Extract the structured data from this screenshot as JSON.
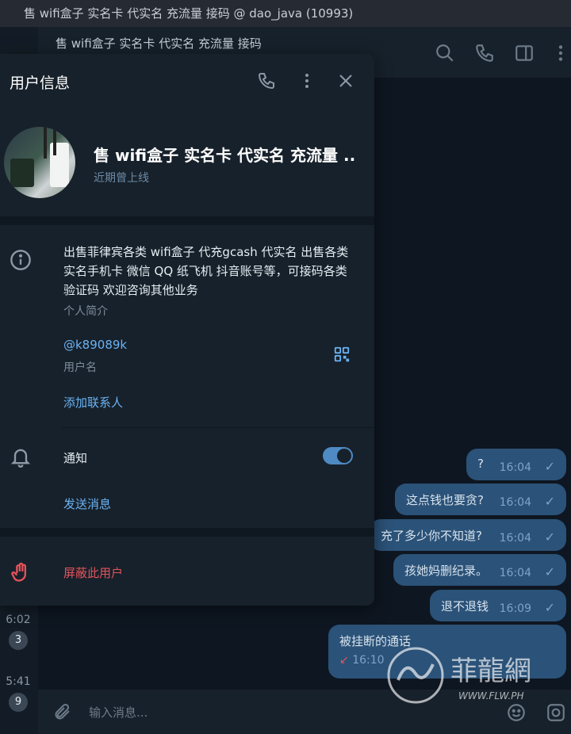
{
  "window": {
    "title": "售 wifi盒子 实名卡 代实名 充流量 接码 @ dao_java (10993)"
  },
  "chat_header": {
    "title": "售 wifi盒子 实名卡 代实名 充流量 接码"
  },
  "left_list": [
    {
      "time": "6:02",
      "badge": "3"
    },
    {
      "time": "5:41",
      "badge": "9"
    }
  ],
  "messages": [
    {
      "text": "?",
      "time": "16:04"
    },
    {
      "text": "这点钱也要贪?",
      "time": "16:04"
    },
    {
      "text": "充了多少你不知道?",
      "time": "16:04"
    },
    {
      "text": "孩她妈删纪录。",
      "time": "16:04"
    },
    {
      "text": "退不退钱",
      "time": "16:09"
    },
    {
      "text": "被挂断的通话",
      "time": "16:10"
    }
  ],
  "composer": {
    "placeholder": "输入消息..."
  },
  "panel": {
    "title": "用户信息",
    "name": "售 wifi盒子 实名卡 代实名 充流量 ...",
    "status": "近期曾上线",
    "bio": "出售菲律宾各类 wifi盒子 代充gcash 代实名 出售各类实名手机卡 微信 QQ 纸飞机 抖音账号等，可接码各类验证码 欢迎咨询其他业务",
    "bio_label": "个人简介",
    "username": "@k89089k",
    "username_label": "用户名",
    "add_contact": "添加联系人",
    "notifications": "通知",
    "notifications_on": true,
    "send_message": "发送消息",
    "block_user": "屏蔽此用户"
  },
  "colors": {
    "accent": "#6ab3f3",
    "danger": "#e5535a",
    "bubble": "#2b5278"
  },
  "watermark": {
    "text": "菲龍網",
    "url": "WWW.FLW.PH"
  }
}
